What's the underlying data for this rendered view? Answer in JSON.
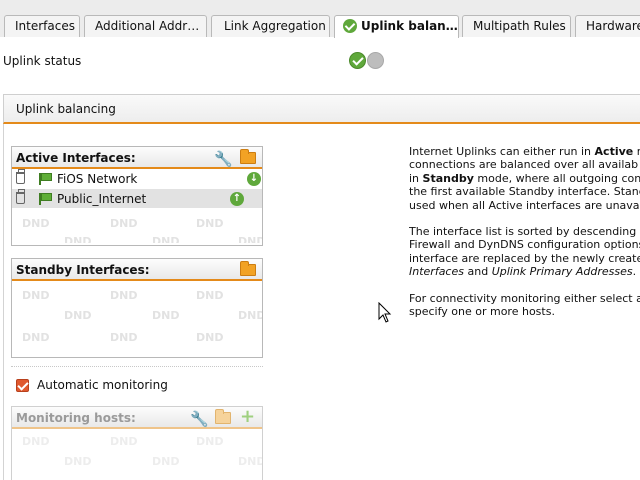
{
  "tabs": [
    {
      "label": "Interfaces",
      "active": false
    },
    {
      "label": "Additional Addr…",
      "active": false
    },
    {
      "label": "Link Aggregation",
      "active": false
    },
    {
      "label": "Uplink balan…",
      "active": true
    },
    {
      "label": "Multipath Rules",
      "active": false
    },
    {
      "label": "Hardware",
      "active": false
    }
  ],
  "uplink_status": {
    "label": "Uplink status",
    "indicators": [
      "status-ok-icon",
      "status-inactive-icon"
    ]
  },
  "panel": {
    "title": "Uplink balancing"
  },
  "active_interfaces": {
    "title": "Active Interfaces:",
    "items": [
      {
        "label": "FiOS Network",
        "arrow": "down",
        "selected": false
      },
      {
        "label": "Public_Internet",
        "arrow": "up",
        "selected": true
      }
    ]
  },
  "standby_interfaces": {
    "title": "Standby Interfaces:",
    "items": []
  },
  "dnd_placeholder": "DND",
  "automatic_monitoring": {
    "label": "Automatic monitoring",
    "checked": true
  },
  "monitoring_hosts": {
    "title": "Monitoring hosts:",
    "disabled": true
  },
  "description": {
    "p1": [
      "Internet Uplinks can either run in ",
      "Active",
      " m",
      "connections are balanced over all availab",
      "in ",
      "Standby",
      " mode, where all outgoing conn",
      "the first available Standby interface. Standb",
      "used when all Active interfaces are unavaila"
    ],
    "p2": [
      "The interface list is sorted by descending p",
      "Firewall and DynDNS configuration options",
      "interface are replaced by the newly created",
      "Interfaces",
      " and ",
      "Uplink Primary Addresses",
      "."
    ],
    "p3": [
      "For connectivity monitoring either select au",
      "specify one or more hosts."
    ]
  },
  "colors": {
    "accent": "#e48a1a",
    "ok_green": "#5fa83b",
    "checkbox": "#e0592f"
  }
}
